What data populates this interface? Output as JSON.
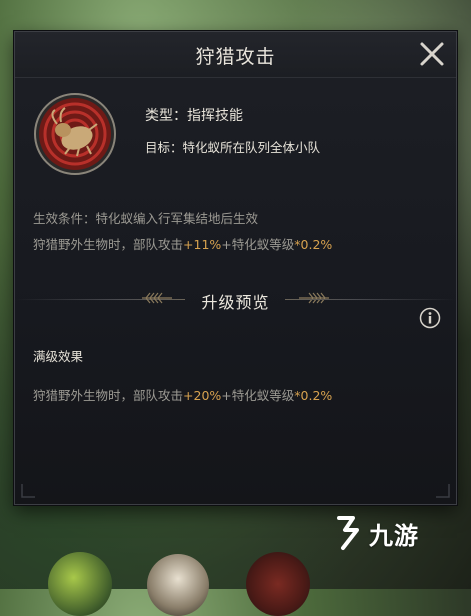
{
  "dialog": {
    "title": "狩猎攻击",
    "close_icon": "close-icon",
    "skill_icon": "beetle-icon",
    "type_label": "类型：指挥技能",
    "target_label": "目标：特化蚁所在队列全体小队",
    "condition": "生效条件：特化蚁编入行军集结地后生效",
    "effect_current": {
      "prefix": "狩猎野外生物时，部队攻击",
      "value": "+11%",
      "middle": "+特化蚁等级",
      "suffix": "*0.2%"
    },
    "section_title": "升级预览",
    "info_icon": "info-icon",
    "max_label": "满级效果",
    "effect_max": {
      "prefix": "狩猎野外生物时，部队攻击",
      "value": "+20%",
      "middle": "+特化蚁等级",
      "suffix": "*0.2%"
    }
  },
  "watermark": {
    "text": "九游"
  },
  "colors": {
    "highlight": "#d7a24f",
    "dialog_bg": "#1a1c21",
    "text_primary": "#e6e2d8",
    "text_secondary": "#9c9a93"
  }
}
